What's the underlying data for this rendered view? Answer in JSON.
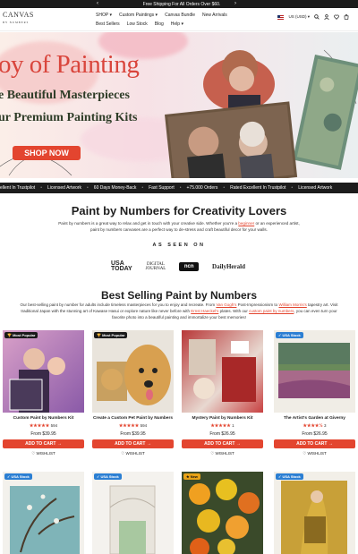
{
  "topbar": {
    "message": "Free Shipping For All Orders Over $60."
  },
  "brand": {
    "name": "CANVAS",
    "sub": "BY NUMBERS"
  },
  "nav": [
    "SHOP ▾",
    "Custom Paintings ▾",
    "Canvas Bundle",
    "New Arrivals",
    "Best Sellers",
    "Low Stock",
    "Blog",
    "Help ▾"
  ],
  "header": {
    "currency": "US (USD) ▾"
  },
  "hero": {
    "title": "oy of Painting",
    "line1": "e Beautiful Masterpieces",
    "line2": "ur Premium Painting Kits",
    "cta": "SHOP NOW"
  },
  "ticker": [
    "ellent In Trustpilot",
    "Licensed Artwork",
    "60 Days Money-Back",
    "Fast Support",
    "+75.000 Orders",
    "Rated Excellent In Trustpilot",
    "Licensed Artwork"
  ],
  "intro": {
    "title": "Paint by Numbers for Creativity Lovers",
    "p1": "Paint by numbers is a great way to relax and get in touch with your creative side. Whether you're a ",
    "link": "beginner",
    "p2": " or an experienced artist,",
    "p3": "paint by numbers canvases are a perfect way to de-stress and craft beautiful decor for your walls."
  },
  "seen": {
    "label": "AS SEEN ON",
    "usa": "USA\nTODAY",
    "digital": "DIGITAL\nJOURNAL",
    "ncn": "ncn",
    "herald": "DailyHerald"
  },
  "best": {
    "title": "Best Selling Paint by Numbers",
    "t1": "Our best-selling paint by number for adults include timeless masterpieces for you to enjoy and recreate. From ",
    "l1": "Van Gogh's",
    "t2": " Post-Impressionism to ",
    "l2": "William Morris's",
    "t3": " tapestry art. Visit",
    "t4": "traditional Japan with the stunning art of Kawase Hasui or explore nature like never before with ",
    "l3": "Ernst Haeckel's",
    "t5": " plates. With our ",
    "l4": "custom paint by numbers",
    "t6": ", you can even turn your",
    "t7": "favorite photo into a beautiful painting and immortalize your best memories!"
  },
  "products": [
    {
      "badge": "🏆 Most Popular",
      "title": "Custom Paint by Numbers Kit",
      "rating": "★★★★★",
      "count": "594",
      "price": "From $39.95",
      "cart": "ADD TO CART →",
      "wish": "♡ WISHLIST"
    },
    {
      "badge": "🏆 Most Popular",
      "title": "Create a Custom Pet Paint by Numbers",
      "rating": "★★★★★",
      "count": "594",
      "price": "From $39.95",
      "cart": "ADD TO CART →",
      "wish": "♡ WISHLIST"
    },
    {
      "badge": "",
      "title": "Mystery Paint by Numbers Kit",
      "rating": "★★★★★",
      "count": "1",
      "price": "From $26.95",
      "cart": "ADD TO CART →",
      "wish": "♡ WISHLIST"
    },
    {
      "badge": "✓ USA Stock",
      "title": "The Artist's Garden at Giverny",
      "rating": "★★★★½",
      "count": "3",
      "price": "From $26.95",
      "cart": "ADD TO CART →",
      "wish": "♡ WISHLIST"
    }
  ],
  "row2": [
    "✓ USA Stock",
    "✓ USA Stock",
    "★ New",
    "✓ USA Stock"
  ],
  "colors": {
    "accent": "#e3452f",
    "dark": "#1c1c1c"
  }
}
